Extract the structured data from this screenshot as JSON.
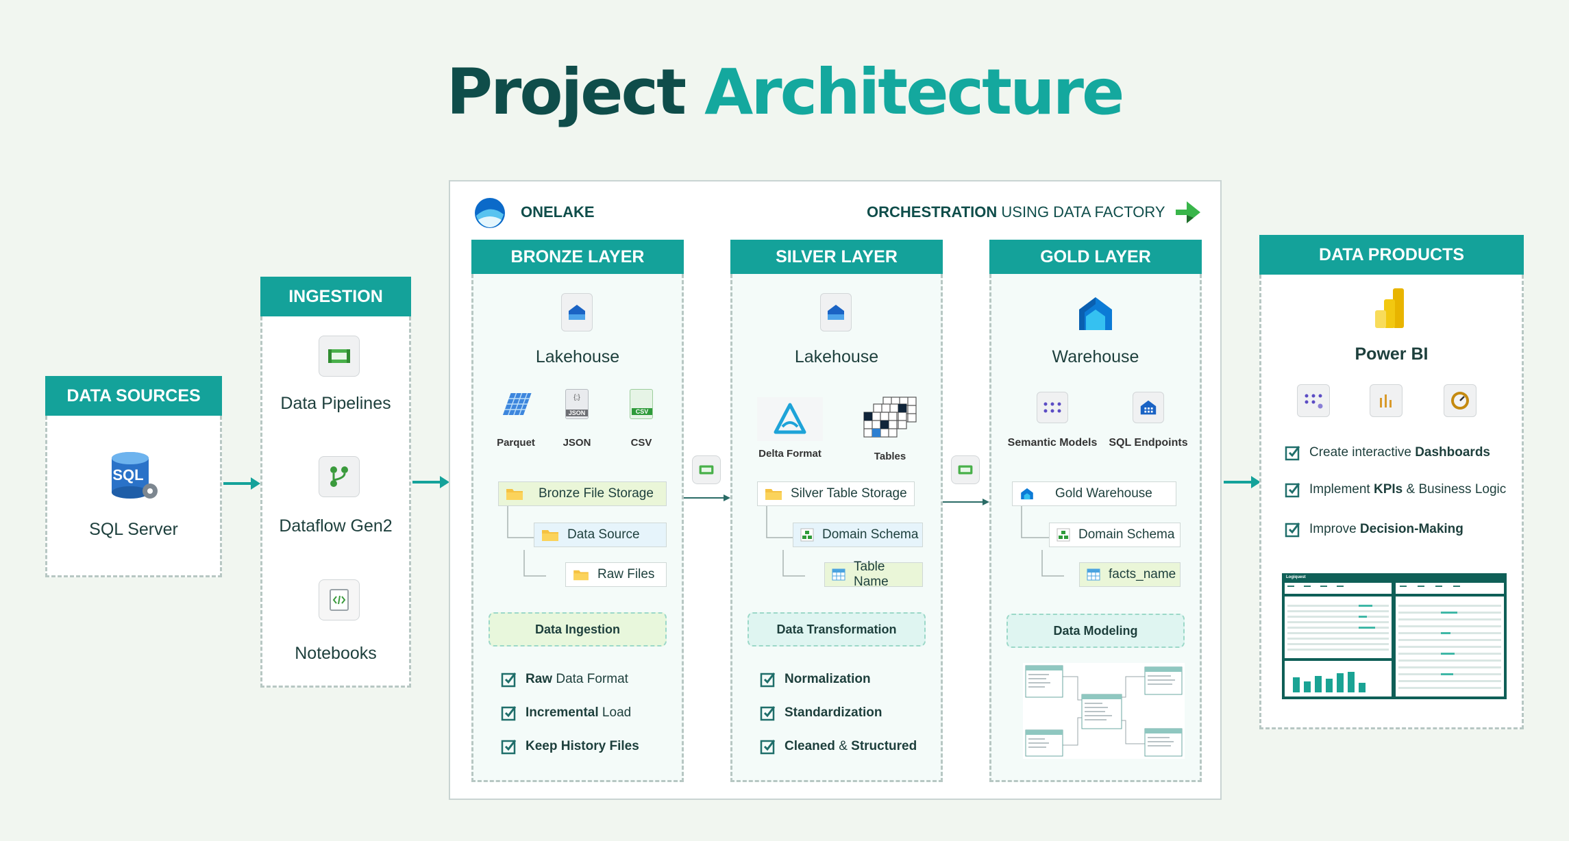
{
  "title": {
    "part1": "Project",
    "part2": "Architecture"
  },
  "data_sources": {
    "header": "DATA SOURCES",
    "item": "SQL Server",
    "icon_text": "SQL"
  },
  "ingestion": {
    "header": "INGESTION",
    "items": [
      "Data Pipelines",
      "Dataflow Gen2",
      "Notebooks"
    ]
  },
  "onelake": {
    "label": "ONELAKE",
    "orchestration_bold": "ORCHESTRATION",
    "orchestration_rest": " USING DATA FACTORY"
  },
  "bronze": {
    "header": "BRONZE LAYER",
    "store": "Lakehouse",
    "formats": [
      "Parquet",
      "JSON",
      "CSV"
    ],
    "format_badges": [
      "{;}",
      "JSON",
      "CSV"
    ],
    "tree": [
      "Bronze File Storage",
      "Data Source",
      "Raw Files"
    ],
    "stage": "Data Ingestion",
    "checks": [
      {
        "bold": "Raw",
        "rest": " Data Format"
      },
      {
        "bold": "Incremental",
        "rest": " Load"
      },
      {
        "bold": "Keep History Files",
        "rest": ""
      }
    ]
  },
  "silver": {
    "header": "SILVER LAYER",
    "store": "Lakehouse",
    "formats": [
      "Delta Format",
      "Tables"
    ],
    "tree": [
      "Silver Table Storage",
      "Domain Schema",
      "Table Name"
    ],
    "stage": "Data Transformation",
    "checks": [
      {
        "bold": "Normalization",
        "rest": ""
      },
      {
        "bold": "Standardization",
        "rest": ""
      },
      {
        "bold": "Cleaned",
        "rest": " & ",
        "bold2": "Structured"
      }
    ]
  },
  "gold": {
    "header": "GOLD LAYER",
    "store": "Warehouse",
    "formats": [
      "Semantic Models",
      "SQL Endpoints"
    ],
    "tree": [
      "Gold Warehouse",
      "Domain Schema",
      "facts_name"
    ],
    "stage": "Data Modeling",
    "er_tables": [
      "dim_product",
      "dim_customer",
      "fact_sales",
      "dim_date",
      "dim_store"
    ]
  },
  "data_products": {
    "header": "DATA PRODUCTS",
    "item": "Power BI",
    "checks": [
      {
        "pre": "Create interactive ",
        "bold": "Dashboards",
        "post": ""
      },
      {
        "pre": "Implement ",
        "bold": "KPIs",
        "post": " & Business Logic"
      },
      {
        "pre": "Improve ",
        "bold": "Decision-Making",
        "post": ""
      }
    ],
    "dashboard_title": "Logiquest"
  },
  "colors": {
    "teal": "#14a29a",
    "dark_teal": "#0f4d4a",
    "background": "#f1f6f0"
  },
  "icons": [
    "sql-server-icon",
    "pipeline-icon",
    "dataflow-icon",
    "notebook-icon",
    "onelake-icon",
    "data-factory-icon",
    "lakehouse-icon",
    "parquet-icon",
    "json-icon",
    "csv-icon",
    "delta-icon",
    "tables-icon",
    "warehouse-icon",
    "semantic-model-icon",
    "sql-endpoint-icon",
    "powerbi-icon",
    "folder-icon",
    "schema-icon",
    "table-icon",
    "check-icon",
    "arrow-icon"
  ]
}
